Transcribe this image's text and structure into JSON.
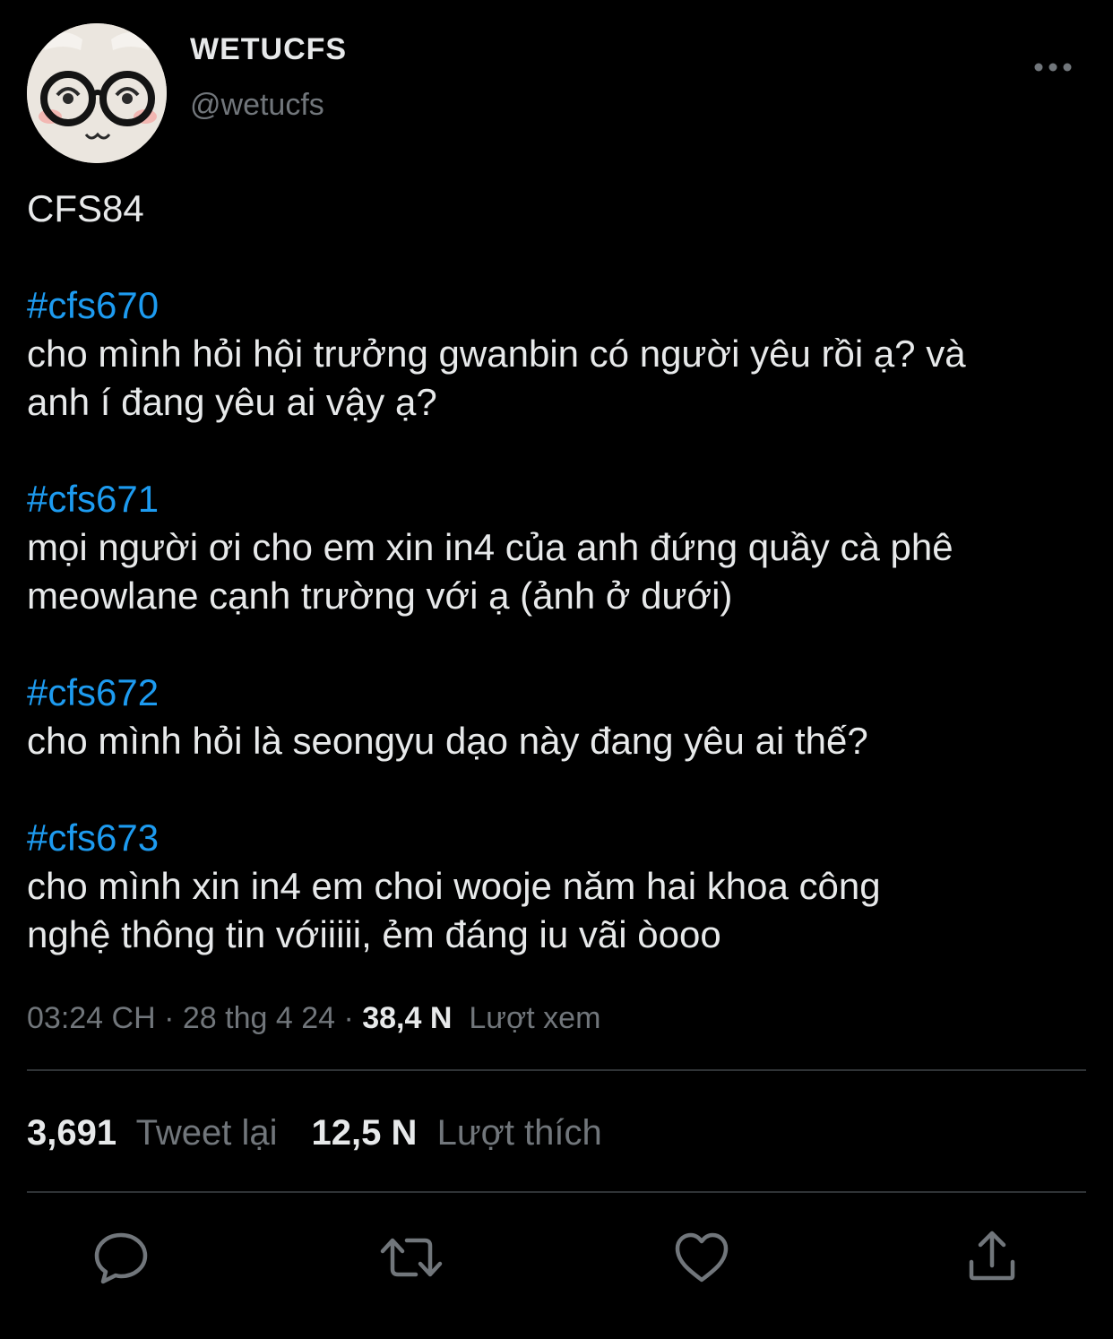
{
  "user": {
    "display_name": "WETUCFS",
    "handle": "@wetucfs",
    "avatar_icon": "cartoon-glasses-face-avatar"
  },
  "menu": {
    "more_icon": "more-dots-icon"
  },
  "tweet": {
    "intro": "CFS84",
    "entries": [
      {
        "tag": "#cfs670",
        "lines": [
          "cho mình hỏi hội trưởng gwanbin có người yêu rồi ạ? và",
          "anh í đang yêu ai vậy ạ?"
        ]
      },
      {
        "tag": "#cfs671",
        "lines": [
          "mọi người ơi cho em xin in4 của anh đứng quầy cà phê",
          "meowlane cạnh trường với ạ (ảnh ở dưới)"
        ]
      },
      {
        "tag": "#cfs672",
        "lines": [
          "cho mình hỏi là seongyu dạo này đang yêu ai thế?"
        ]
      },
      {
        "tag": "#cfs673",
        "lines": [
          "cho mình xin in4 em choi wooje năm hai khoa công",
          "nghệ thông tin vớiiiii, ẻm đáng iu vãi òooo"
        ]
      }
    ]
  },
  "meta": {
    "time": "03:24 CH",
    "separator": " · ",
    "date": "28 thg 4 24",
    "views_count": "38,4 N",
    "views_label": "Lượt xem"
  },
  "stats": {
    "retweets_count": "3,691",
    "retweets_label": "Tweet lại",
    "likes_count": "12,5 N",
    "likes_label": "Lượt thích"
  },
  "actions": {
    "reply_icon": "reply-icon",
    "retweet_icon": "retweet-icon",
    "like_icon": "heart-icon",
    "share_icon": "share-icon"
  },
  "colors": {
    "background": "#000000",
    "text": "#e7e9ea",
    "secondary": "#71767b",
    "accent": "#1d9bf0",
    "divider": "#2f3336"
  }
}
